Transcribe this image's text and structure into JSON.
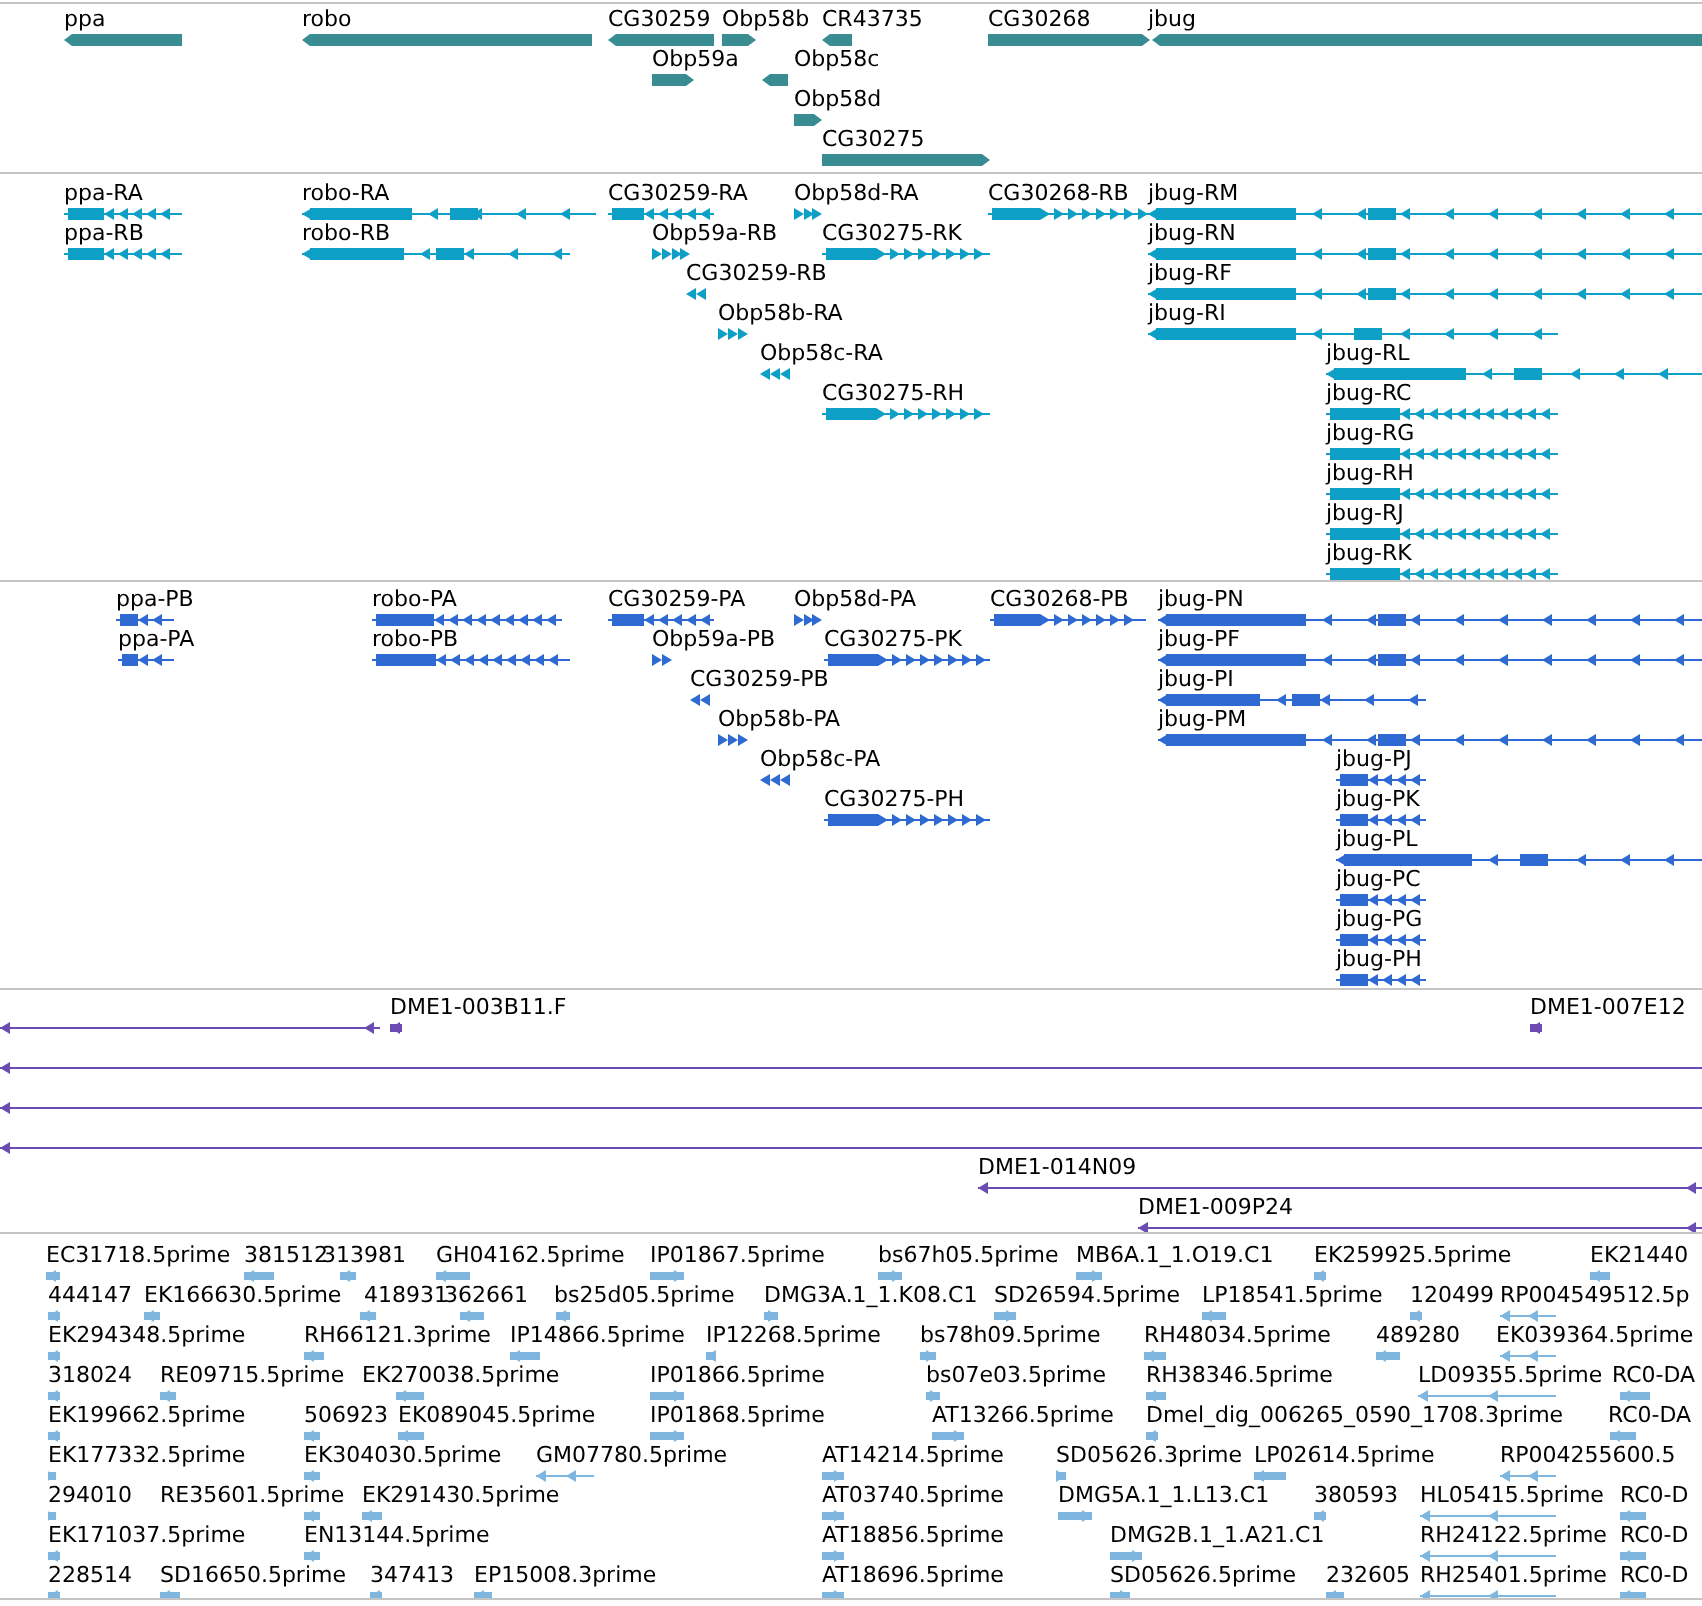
{
  "tracks": [
    {
      "kind": "gene",
      "features": [
        {
          "label": "ppa",
          "reverse": true
        },
        {
          "label": "robo",
          "reverse": true
        },
        {
          "label": "CG30259",
          "reverse": true
        },
        {
          "label": "Obp58b",
          "reverse": false
        },
        {
          "label": "CR43735",
          "reverse": true
        },
        {
          "label": "CG30268",
          "reverse": false
        },
        {
          "label": "jbug",
          "reverse": true
        },
        {
          "label": "Obp59a",
          "reverse": false
        },
        {
          "label": "Obp58c",
          "reverse": true
        },
        {
          "label": "Obp58d",
          "reverse": false
        },
        {
          "label": "CG30275",
          "reverse": false
        }
      ]
    },
    {
      "kind": "transcript",
      "features": [
        {
          "label": "ppa-RA",
          "reverse": true
        },
        {
          "label": "robo-RA",
          "reverse": true
        },
        {
          "label": "CG30259-RA",
          "reverse": true
        },
        {
          "label": "Obp58d-RA",
          "reverse": false
        },
        {
          "label": "CG30268-RB",
          "reverse": false
        },
        {
          "label": "jbug-RM",
          "reverse": true
        },
        {
          "label": "ppa-RB",
          "reverse": true
        },
        {
          "label": "robo-RB",
          "reverse": true
        },
        {
          "label": "Obp59a-RB",
          "reverse": false
        },
        {
          "label": "CG30275-RK",
          "reverse": false
        },
        {
          "label": "jbug-RN",
          "reverse": true
        },
        {
          "label": "CG30259-RB",
          "reverse": true
        },
        {
          "label": "jbug-RF",
          "reverse": true
        },
        {
          "label": "Obp58b-RA",
          "reverse": false
        },
        {
          "label": "jbug-RI",
          "reverse": true
        },
        {
          "label": "Obp58c-RA",
          "reverse": true
        },
        {
          "label": "jbug-RL",
          "reverse": true
        },
        {
          "label": "CG30275-RH",
          "reverse": false
        },
        {
          "label": "jbug-RC",
          "reverse": true
        },
        {
          "label": "jbug-RG",
          "reverse": true
        },
        {
          "label": "jbug-RH",
          "reverse": true
        },
        {
          "label": "jbug-RJ",
          "reverse": true
        },
        {
          "label": "jbug-RK",
          "reverse": true
        }
      ]
    },
    {
      "kind": "protein",
      "features": [
        {
          "label": "ppa-PB",
          "reverse": true
        },
        {
          "label": "robo-PA",
          "reverse": true
        },
        {
          "label": "CG30259-PA",
          "reverse": true
        },
        {
          "label": "Obp58d-PA",
          "reverse": false
        },
        {
          "label": "CG30268-PB",
          "reverse": false
        },
        {
          "label": "jbug-PN",
          "reverse": true
        },
        {
          "label": "ppa-PA",
          "reverse": true
        },
        {
          "label": "robo-PB",
          "reverse": true
        },
        {
          "label": "Obp59a-PB",
          "reverse": false
        },
        {
          "label": "CG30275-PK",
          "reverse": false
        },
        {
          "label": "jbug-PF",
          "reverse": true
        },
        {
          "label": "CG30259-PB",
          "reverse": true
        },
        {
          "label": "jbug-PI",
          "reverse": true
        },
        {
          "label": "Obp58b-PA",
          "reverse": false
        },
        {
          "label": "jbug-PM",
          "reverse": true
        },
        {
          "label": "Obp58c-PA",
          "reverse": true
        },
        {
          "label": "jbug-PJ",
          "reverse": true
        },
        {
          "label": "CG30275-PH",
          "reverse": false
        },
        {
          "label": "jbug-PK",
          "reverse": true
        },
        {
          "label": "jbug-PL",
          "reverse": true
        },
        {
          "label": "jbug-PC",
          "reverse": true
        },
        {
          "label": "jbug-PG",
          "reverse": true
        },
        {
          "label": "jbug-PH",
          "reverse": true
        }
      ]
    },
    {
      "kind": "clone",
      "features": [
        {
          "reverse": true
        },
        {
          "label": "DME1-003B11.F",
          "reverse": true
        },
        {
          "label": "DME1-007E12",
          "reverse": true
        },
        {
          "reverse": true
        },
        {
          "reverse": true
        },
        {
          "reverse": true
        },
        {
          "label": "DME1-014N09",
          "reverse": true
        },
        {
          "label": "DME1-009P24",
          "reverse": true
        }
      ]
    },
    {
      "kind": "est",
      "features": [
        {
          "label": "EC31718.5prime",
          "reverse": true
        },
        {
          "label": "381512",
          "reverse": true
        },
        {
          "label": "313981",
          "reverse": true
        },
        {
          "label": "GH04162.5prime",
          "reverse": true
        },
        {
          "label": "IP01867.5prime",
          "reverse": false
        },
        {
          "label": "bs67h05.5prime",
          "reverse": false
        },
        {
          "label": "MB6A.1_1.O19.C1",
          "reverse": false
        },
        {
          "label": "EK259925.5prime",
          "reverse": true
        },
        {
          "label": "EK21440",
          "reverse": true
        },
        {
          "label": "444147",
          "reverse": true
        },
        {
          "label": "EK166630.5prime",
          "reverse": true
        },
        {
          "label": "418931",
          "reverse": true
        },
        {
          "label": "362661",
          "reverse": true
        },
        {
          "label": "bs25d05.5prime",
          "reverse": true
        },
        {
          "label": "DMG3A.1_1.K08.C1",
          "reverse": false
        },
        {
          "label": "SD26594.5prime",
          "reverse": false
        },
        {
          "label": "LP18541.5prime",
          "reverse": true
        },
        {
          "label": "120499",
          "reverse": true
        },
        {
          "label": "RP004549512.5p",
          "reverse": true
        },
        {
          "label": "EK294348.5prime",
          "reverse": true
        },
        {
          "label": "RH66121.3prime",
          "reverse": true
        },
        {
          "label": "IP14866.5prime",
          "reverse": true
        },
        {
          "label": "IP12268.5prime",
          "reverse": true
        },
        {
          "label": "bs78h09.5prime",
          "reverse": false
        },
        {
          "label": "RH48034.5prime",
          "reverse": true
        },
        {
          "label": "489280",
          "reverse": true
        },
        {
          "label": "EK039364.5prime",
          "reverse": true
        },
        {
          "label": "318024",
          "reverse": true
        },
        {
          "label": "RE09715.5prime",
          "reverse": true
        },
        {
          "label": "EK270038.5prime",
          "reverse": true
        },
        {
          "label": "IP01866.5prime",
          "reverse": false
        },
        {
          "label": "bs07e03.5prime",
          "reverse": false
        },
        {
          "label": "RH38346.5prime",
          "reverse": true
        },
        {
          "label": "LD09355.5prime",
          "reverse": true
        },
        {
          "label": "RC0-DA",
          "reverse": true
        },
        {
          "label": "EK199662.5prime",
          "reverse": true
        },
        {
          "label": "506923",
          "reverse": true
        },
        {
          "label": "EK089045.5prime",
          "reverse": true
        },
        {
          "label": "IP01868.5prime",
          "reverse": false
        },
        {
          "label": "AT13266.5prime",
          "reverse": false
        },
        {
          "label": "Dmel_dig_006265_0590_1708.3prime",
          "reverse": true
        },
        {
          "label": "RC0-DA",
          "reverse": true
        },
        {
          "label": "EK177332.5prime",
          "reverse": false
        },
        {
          "label": "EK304030.5prime",
          "reverse": true
        },
        {
          "label": "GM07780.5prime",
          "reverse": true
        },
        {
          "label": "AT14214.5prime",
          "reverse": false
        },
        {
          "label": "SD05626.3prime",
          "reverse": false
        },
        {
          "label": "LP02614.5prime",
          "reverse": true
        },
        {
          "label": "RP004255600.5",
          "reverse": true
        },
        {
          "label": "294010",
          "reverse": false
        },
        {
          "label": "RE35601.5prime",
          "reverse": true
        },
        {
          "label": "EK291430.5prime",
          "reverse": true
        },
        {
          "label": "AT03740.5prime",
          "reverse": false
        },
        {
          "label": "DMG5A.1_1.L13.C1",
          "reverse": false
        },
        {
          "label": "380593",
          "reverse": true
        },
        {
          "label": "HL05415.5prime",
          "reverse": true
        },
        {
          "label": "RC0-D",
          "reverse": true
        },
        {
          "label": "EK171037.5prime",
          "reverse": true
        },
        {
          "label": "EN13144.5prime",
          "reverse": true
        },
        {
          "label": "AT18856.5prime",
          "reverse": false
        },
        {
          "label": "DMG2B.1_1.A21.C1",
          "reverse": false
        },
        {
          "label": "RH24122.5prime",
          "reverse": true
        },
        {
          "label": "RC0-D",
          "reverse": true
        },
        {
          "label": "228514",
          "reverse": true
        },
        {
          "label": "SD16650.5prime",
          "reverse": true
        },
        {
          "label": "347413",
          "reverse": true
        },
        {
          "label": "EP15008.3prime",
          "reverse": true
        },
        {
          "label": "AT18696.5prime",
          "reverse": false
        },
        {
          "label": "SD05626.5prime",
          "reverse": false
        },
        {
          "label": "232605",
          "reverse": true
        },
        {
          "label": "RH25401.5prime",
          "reverse": true
        },
        {
          "label": "RC0-D",
          "reverse": true
        }
      ]
    }
  ]
}
